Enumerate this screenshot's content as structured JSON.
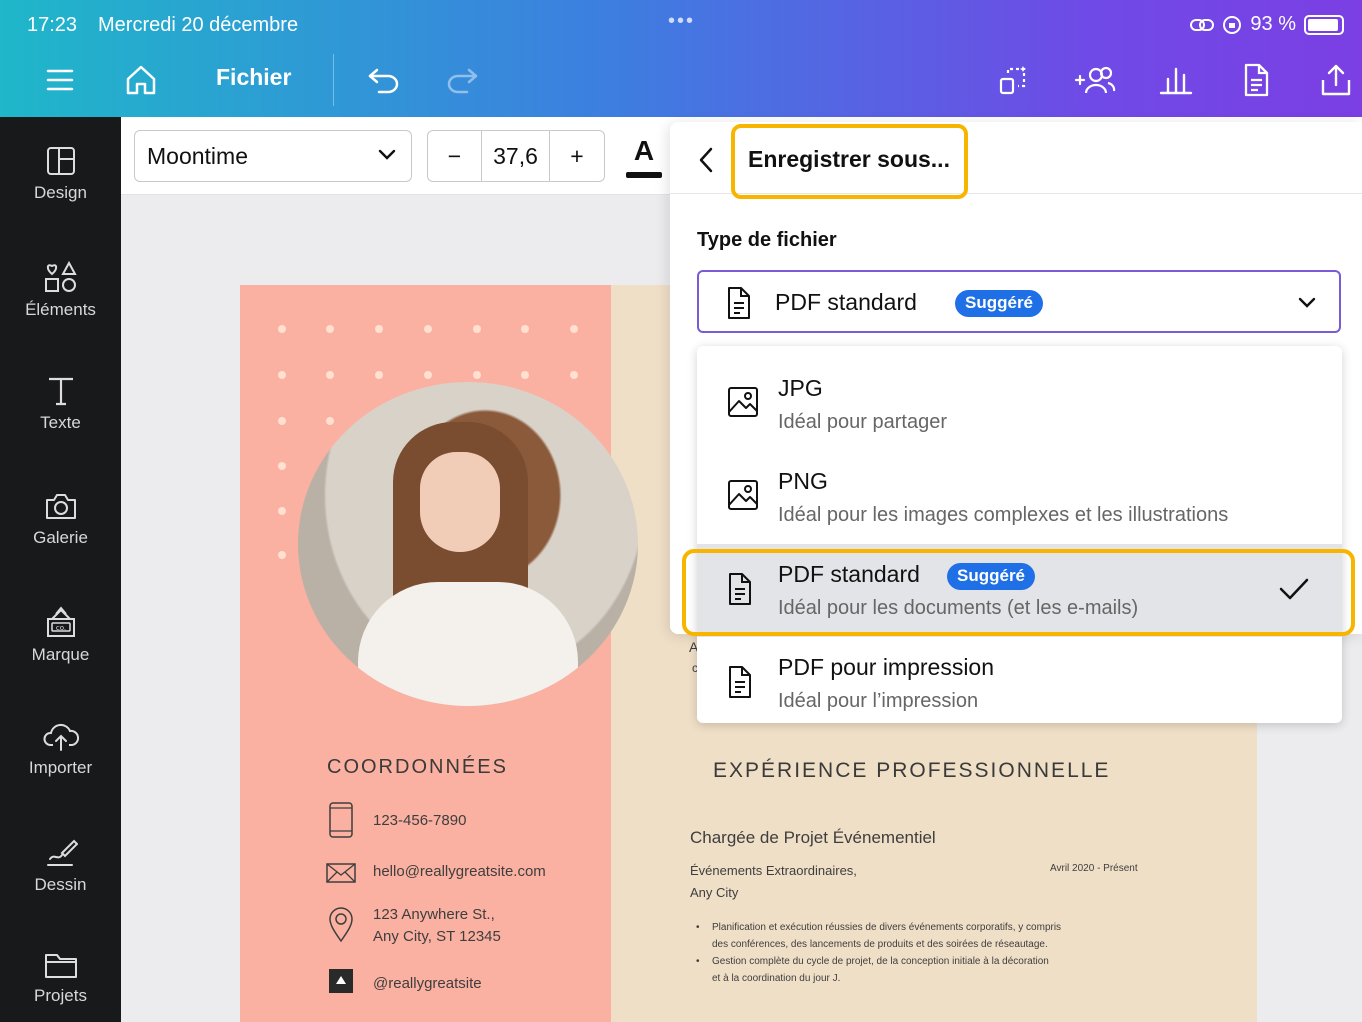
{
  "status": {
    "time": "17:23",
    "date": "Mercredi 20 décembre",
    "dots": "•••",
    "battery": "93 %"
  },
  "toolbar": {
    "file_menu": "Fichier"
  },
  "sidebar": {
    "items": [
      {
        "label": "Design",
        "icon": "layout-icon"
      },
      {
        "label": "Éléments",
        "icon": "shapes-icon"
      },
      {
        "label": "Texte",
        "icon": "text-icon"
      },
      {
        "label": "Galerie",
        "icon": "camera-icon"
      },
      {
        "label": "Marque",
        "icon": "brand-icon"
      },
      {
        "label": "Importer",
        "icon": "cloud-upload-icon"
      },
      {
        "label": "Dessin",
        "icon": "draw-icon"
      },
      {
        "label": "Projets",
        "icon": "folder-icon"
      }
    ]
  },
  "format_bar": {
    "font": "Moontime",
    "size": "37,6",
    "minus": "−",
    "plus": "+",
    "text_color_glyph": "A"
  },
  "resume": {
    "contact_title": "COORDONNÉES",
    "phone": "123-456-7890",
    "email": "hello@reallygreatsite.com",
    "address_line1": "123 Anywhere St.,",
    "address_line2": "Any City, ST 12345",
    "social": "@reallygreatsite",
    "exp_title": "EXPÉRIENCE PROFESSIONNELLE",
    "job_title": "Chargée de Projet Événementiel",
    "company_line1": "Événements Extraordinaires,",
    "company_line2": "Any City",
    "period": "Avril 2020 - Présent",
    "bullet1_l1": "Planification et exécution réussies de divers événements corporatifs, y compris",
    "bullet1_l2": "des conférences, des lancements de produits et des soirées de réseautage.",
    "bullet2_l1": "Gestion complète du cycle de projet, de la conception initiale à la décoration",
    "bullet2_l2": "et à la coordination du jour J.",
    "partial_a": "A",
    "partial_c": "c"
  },
  "export_panel": {
    "title": "Enregistrer sous...",
    "file_type_label": "Type de fichier",
    "selected_value": "PDF standard",
    "selected_badge": "Suggéré",
    "options": [
      {
        "name": "JPG",
        "desc": "Idéal pour partager",
        "icon": "image-icon"
      },
      {
        "name": "PNG",
        "desc": "Idéal pour les images complexes et les illustrations",
        "icon": "image-icon"
      },
      {
        "name": "PDF standard",
        "badge": "Suggéré",
        "desc": "Idéal pour les documents (et les e-mails)",
        "icon": "document-icon",
        "selected": true
      },
      {
        "name": "PDF pour impression",
        "desc": "Idéal pour l’impression",
        "icon": "document-icon"
      }
    ]
  },
  "colors": {
    "accent_purple": "#7b5bd5",
    "badge_blue": "#1f6fe6",
    "highlight": "#f8b500",
    "resume_pink": "#fbb1a1",
    "resume_beige": "#f0dfc7"
  }
}
